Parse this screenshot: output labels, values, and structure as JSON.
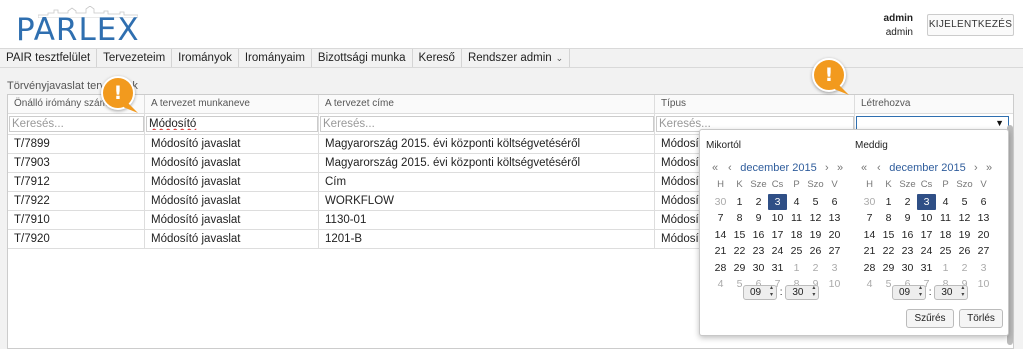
{
  "app": {
    "logo_text": "PARLEX"
  },
  "user": {
    "line1": "admin",
    "line2": "admin",
    "logout_label": "KIJELENTKEZÉS"
  },
  "nav": {
    "items": [
      "PAIR tesztfelület",
      "Tervezeteim",
      "Irományok",
      "Irományaim",
      "Bizottsági munka",
      "Kereső",
      "Rendszer admin"
    ]
  },
  "section_title": "Törvényjavaslat tervezetek",
  "table": {
    "headers": [
      "Önálló irómány szám",
      "A tervezet munkaneve",
      "A tervezet címe",
      "Típus",
      "Létrehozva"
    ],
    "filters": {
      "placeholder": "Keresés...",
      "munkaneve_value": "Módosító"
    },
    "rows": [
      [
        "T/7899",
        "Módosító javaslat",
        "Magyarország 2015. évi központi költségvetéséről",
        "Módosító"
      ],
      [
        "T/7903",
        "Módosító javaslat",
        "Magyarország 2015. évi központi költségvetéséről",
        "Módosító"
      ],
      [
        "T/7912",
        "Módosító javaslat",
        "Cím",
        "Módosító"
      ],
      [
        "T/7922",
        "Módosító javaslat",
        "WORKFLOW",
        "Módosító"
      ],
      [
        "T/7910",
        "Módosító javaslat",
        "1130-01",
        "Módosító"
      ],
      [
        "T/7920",
        "Módosító javaslat",
        "1201-B",
        "Módosító"
      ]
    ]
  },
  "datepicker": {
    "from_label": "Mikortól",
    "to_label": "Meddig",
    "month_title": "december 2015",
    "nav": {
      "prev_year": "«",
      "prev_month": "‹",
      "next_month": "›",
      "next_year": "»"
    },
    "weekdays": [
      "H",
      "K",
      "Sze",
      "Cs",
      "P",
      "Szo",
      "V"
    ],
    "weeks": [
      [
        "30",
        "1",
        "2",
        "3",
        "4",
        "5",
        "6"
      ],
      [
        "7",
        "8",
        "9",
        "10",
        "11",
        "12",
        "13"
      ],
      [
        "14",
        "15",
        "16",
        "17",
        "18",
        "19",
        "20"
      ],
      [
        "21",
        "22",
        "23",
        "24",
        "25",
        "26",
        "27"
      ],
      [
        "28",
        "29",
        "30",
        "31",
        "1",
        "2",
        "3"
      ],
      [
        "4",
        "5",
        "6",
        "7",
        "8",
        "9",
        "10"
      ]
    ],
    "selected_day": "3",
    "time_hour": "09",
    "time_minute": "30",
    "time_sep": ":",
    "filter_button": "Szűrés",
    "clear_button": "Törlés"
  },
  "badges": {
    "symbol": "!"
  },
  "colors": {
    "accent": "#2f4f86",
    "badge": "#f29a1e",
    "logo": "#2f6fb0"
  }
}
